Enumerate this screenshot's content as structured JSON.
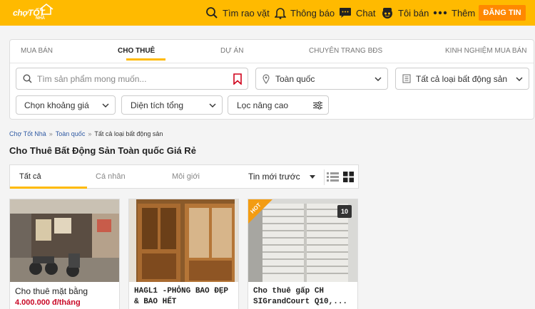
{
  "brand": {
    "logo_main": "chợTỐT",
    "logo_sub": "NHÀ",
    "accent_color": "#ffba00",
    "post_color": "#ff8800",
    "price_color": "#c90927"
  },
  "header": {
    "nav": [
      {
        "label": "Tìm rao vặt",
        "icon": "search-icon"
      },
      {
        "label": "Thông báo",
        "icon": "bell-icon"
      },
      {
        "label": "Chat",
        "icon": "chat-icon"
      },
      {
        "label": "Tôi bán",
        "icon": "user-face-icon"
      },
      {
        "label": "Thêm",
        "icon": "more-dots-icon"
      }
    ],
    "post_button": "ĐĂNG TIN"
  },
  "search_panel": {
    "tabs": [
      "MUA BÁN",
      "CHO THUÊ",
      "DỰ ÁN",
      "CHUYÊN TRANG BĐS",
      "KINH NGHIỆM MUA BÁN"
    ],
    "active_tab": "CHO THUÊ",
    "search_placeholder": "Tìm sản phẩm mong muốn...",
    "location": "Toàn quốc",
    "category": "Tất cả loại bất động sản",
    "price": "Chọn khoảng giá",
    "area": "Diện tích tổng",
    "advanced": "Lọc nâng cao"
  },
  "breadcrumb": {
    "items": [
      "Chợ Tốt Nhà",
      "Toàn quốc",
      "Tất cả loại bất động sản"
    ],
    "separator": "»"
  },
  "page_title": "Cho Thuê Bất Động Sản Toàn quốc Giá Rẻ",
  "filters": {
    "tabs": [
      "Tất cả",
      "Cá nhân",
      "Môi giới"
    ],
    "active": "Tất cả",
    "sort": "Tin mới trước",
    "views": [
      "list-view-icon",
      "grid-view-icon"
    ]
  },
  "listings": [
    {
      "title": "Cho thuê mặt bằng",
      "price": "4.000.000 đ/tháng",
      "hot": false,
      "image_count": ""
    },
    {
      "title": "HAGL1 -PHỎNG BAO ĐẸP & BAO HẾT",
      "price": "",
      "hot": false,
      "image_count": ""
    },
    {
      "title": "Cho thuê gấp CH SIGrandCourt Q10,...",
      "price": "",
      "hot": true,
      "hot_label": "HOT",
      "image_count": "10"
    }
  ]
}
